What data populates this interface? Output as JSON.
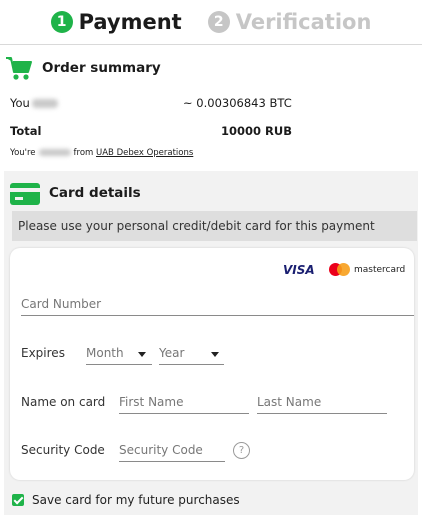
{
  "steps": [
    {
      "num": "1",
      "label": "Payment"
    },
    {
      "num": "2",
      "label": "Verification"
    }
  ],
  "summary": {
    "title": "Order summary",
    "you_label": "You",
    "amount": "~ 0.00306843 BTC",
    "total_label": "Total",
    "total_value": "10000 RUB",
    "note_prefix": "You're",
    "note_from": "from",
    "company": "UAB Debex Operations"
  },
  "card": {
    "title": "Card details",
    "notice": "Please use your personal credit/debit card for this payment",
    "brands": {
      "visa": "VISA",
      "mastercard": "mastercard"
    },
    "card_number_placeholder": "Card Number",
    "expires_label": "Expires",
    "month_value": "Month",
    "year_value": "Year",
    "name_label": "Name on card",
    "first_name_placeholder": "First Name",
    "last_name_placeholder": "Last Name",
    "security_label": "Security Code",
    "security_placeholder": "Security Code",
    "help_symbol": "?",
    "save_label": "Save card for my future purchases",
    "save_checked": true
  },
  "colors": {
    "accent": "#1fb349",
    "inactive": "#c6c6c6",
    "panel": "#f2f2f2"
  }
}
